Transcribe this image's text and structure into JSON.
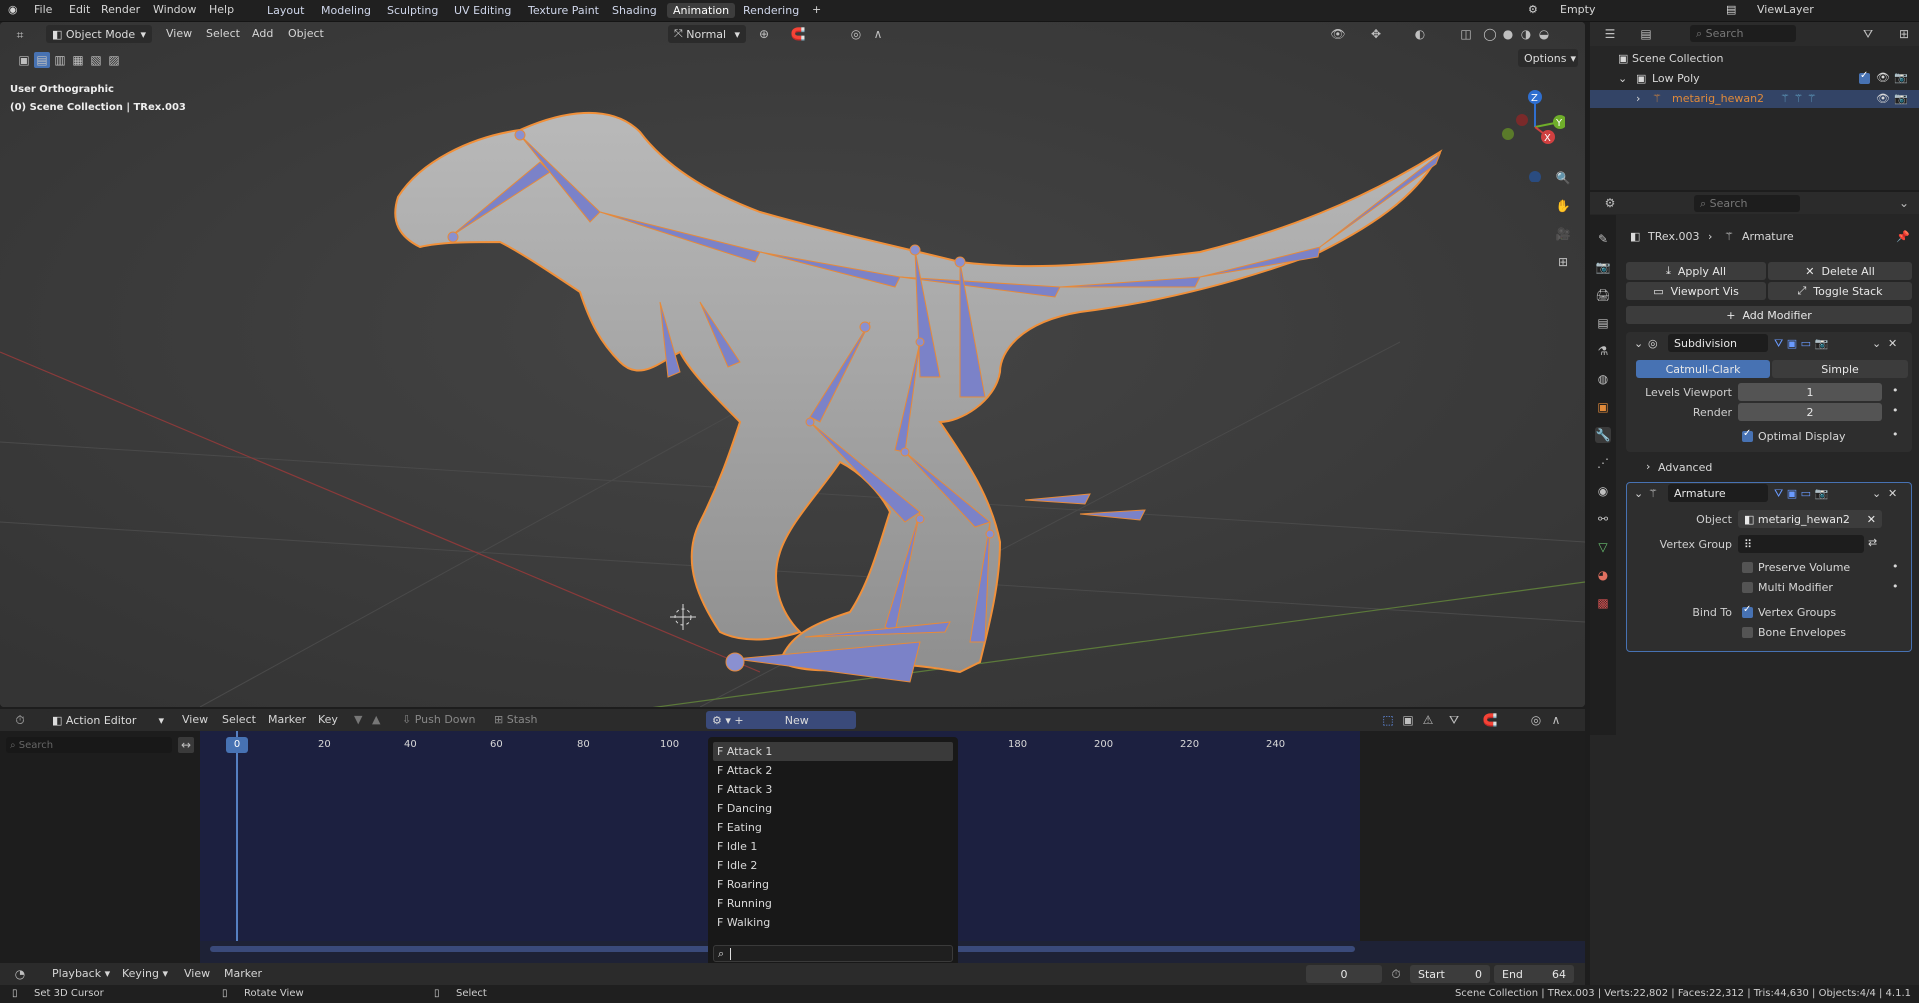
{
  "topbar": {
    "menus": [
      "File",
      "Edit",
      "Render",
      "Window",
      "Help"
    ],
    "workspaces": [
      "Layout",
      "Modeling",
      "Sculpting",
      "UV Editing",
      "Texture Paint",
      "Shading",
      "Animation",
      "Rendering"
    ],
    "active_workspace": "Animation",
    "scene": "Empty",
    "view_layer": "ViewLayer"
  },
  "viewport": {
    "mode": "Object Mode",
    "menus": [
      "View",
      "Select",
      "Add",
      "Object"
    ],
    "orientation": "Normal",
    "options": "Options",
    "overlay_title": "User Orthographic",
    "overlay_sub": "(0) Scene Collection | TRex.003",
    "gizmo": {
      "z": "Z",
      "y": "Y",
      "x": "X"
    }
  },
  "action_editor": {
    "editor": "Action Editor",
    "menus": [
      "View",
      "Select",
      "Marker",
      "Key"
    ],
    "push_down": "Push Down",
    "stash": "Stash",
    "new": "New",
    "search_placeholder": "Search",
    "ruler": [
      "0",
      "20",
      "40",
      "60",
      "80",
      "100",
      "180",
      "200",
      "220",
      "240"
    ],
    "current_frame": "0",
    "actions": [
      "F Attack 1",
      "F Attack 2",
      "F Attack 3",
      "F Dancing",
      "F Eating",
      "F Idle 1",
      "F Idle 2",
      "F Roaring",
      "F Running",
      "F Walking"
    ]
  },
  "playback": {
    "menus": [
      "Playback",
      "Keying",
      "View",
      "Marker"
    ],
    "frame": "0",
    "start_label": "Start",
    "start": "0",
    "end_label": "End",
    "end": "64"
  },
  "status": {
    "left1": "Set 3D Cursor",
    "left2": "Rotate View",
    "left3": "Select",
    "right": "Scene Collection | TRex.003 | Verts:22,802 | Faces:22,312 | Tris:44,630 | Objects:4/4 | 4.1.1"
  },
  "outliner": {
    "search_placeholder": "Search",
    "scene_collection": "Scene Collection",
    "collection": "Low Poly",
    "object": "metarig_hewan2"
  },
  "properties": {
    "search_placeholder": "Search",
    "breadcrumb_obj": "TRex.003",
    "breadcrumb_data": "Armature",
    "apply_all": "Apply All",
    "delete_all": "Delete All",
    "viewport_vis": "Viewport Vis",
    "toggle_stack": "Toggle Stack",
    "add_modifier": "Add Modifier",
    "subdivision": {
      "name": "Subdivision",
      "catmull": "Catmull-Clark",
      "simple": "Simple",
      "levels_label": "Levels Viewport",
      "levels": "1",
      "render_label": "Render",
      "render": "2",
      "optimal": "Optimal Display",
      "advanced": "Advanced"
    },
    "armature": {
      "name": "Armature",
      "object_label": "Object",
      "object": "metarig_hewan2",
      "vgroup_label": "Vertex Group",
      "preserve": "Preserve Volume",
      "multi": "Multi Modifier",
      "bind_label": "Bind To",
      "vgroups": "Vertex Groups",
      "envelopes": "Bone Envelopes"
    }
  },
  "colors": {
    "accent": "#4772b3",
    "selection": "#f0903a",
    "bone": "#7b82c8"
  }
}
